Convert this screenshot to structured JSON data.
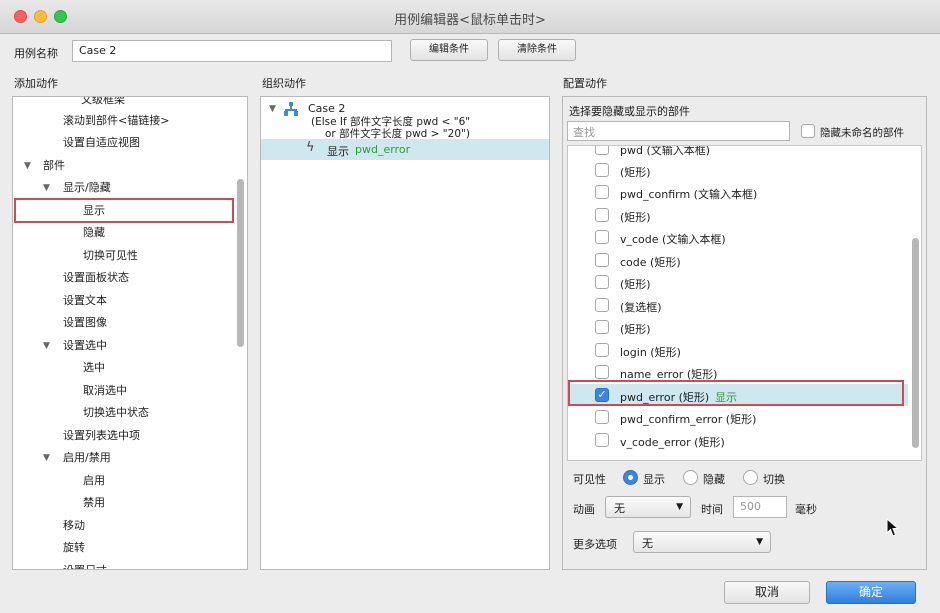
{
  "window": {
    "title": "用例编辑器<鼠标单击时>"
  },
  "case_name": {
    "label": "用例名称",
    "value": "Case 2"
  },
  "toolbar": {
    "edit_condition": "编辑条件",
    "clear_condition": "清除条件"
  },
  "sections": {
    "add_action": "添加动作",
    "organize_action": "组织动作",
    "configure_action": "配置动作"
  },
  "add_actions": {
    "items": [
      "文级框架",
      "滚动到部件<锚链接>",
      "设置自适应视图",
      "部件",
      "显示/隐藏",
      "显示",
      "隐藏",
      "切换可见性",
      "设置面板状态",
      "设置文本",
      "设置图像",
      "设置选中",
      "选中",
      "取消选中",
      "切换选中状态",
      "设置列表选中项",
      "启用/禁用",
      "启用",
      "禁用",
      "移动",
      "旋转",
      "设置尺寸"
    ]
  },
  "organize": {
    "case_title": "Case 2",
    "condition_line1": "(Else If 部件文字长度 pwd < \"6\"",
    "condition_line2": "or 部件文字长度 pwd > \"20\")",
    "action_prefix": "显示",
    "action_target": "pwd_error"
  },
  "configure": {
    "heading": "选择要隐藏或显示的部件",
    "search_placeholder": "查找",
    "hide_unnamed": "隐藏未命名的部件",
    "widgets": [
      {
        "label": "pwd (文输入本框)",
        "checked": false,
        "tag": ""
      },
      {
        "label": "(矩形)",
        "checked": false,
        "tag": ""
      },
      {
        "label": "pwd_confirm (文输入本框)",
        "checked": false,
        "tag": ""
      },
      {
        "label": "(矩形)",
        "checked": false,
        "tag": ""
      },
      {
        "label": "v_code (文输入本框)",
        "checked": false,
        "tag": ""
      },
      {
        "label": "code (矩形)",
        "checked": false,
        "tag": ""
      },
      {
        "label": "(矩形)",
        "checked": false,
        "tag": ""
      },
      {
        "label": "(复选框)",
        "checked": false,
        "tag": ""
      },
      {
        "label": "(矩形)",
        "checked": false,
        "tag": ""
      },
      {
        "label": "login (矩形)",
        "checked": false,
        "tag": ""
      },
      {
        "label": "name_error (矩形)",
        "checked": false,
        "tag": ""
      },
      {
        "label": "pwd_error (矩形)",
        "checked": true,
        "tag": "显示"
      },
      {
        "label": "pwd_confirm_error (矩形)",
        "checked": false,
        "tag": ""
      },
      {
        "label": "v_code_error (矩形)",
        "checked": false,
        "tag": ""
      }
    ],
    "visibility": {
      "label": "可见性",
      "show": "显示",
      "hide": "隐藏",
      "toggle": "切换",
      "selected": "显示"
    },
    "animation": {
      "label": "动画",
      "value": "无",
      "time_label": "时间",
      "time_value": "500",
      "unit": "毫秒"
    },
    "more": {
      "label": "更多选项",
      "value": "无"
    }
  },
  "footer": {
    "cancel": "取消",
    "ok": "确定"
  },
  "colors": {
    "accent": "#3a86e0",
    "highlight_box": "#cd4b56",
    "selected_row": "#cfe8ef",
    "action_green": "#2e9a3e"
  }
}
